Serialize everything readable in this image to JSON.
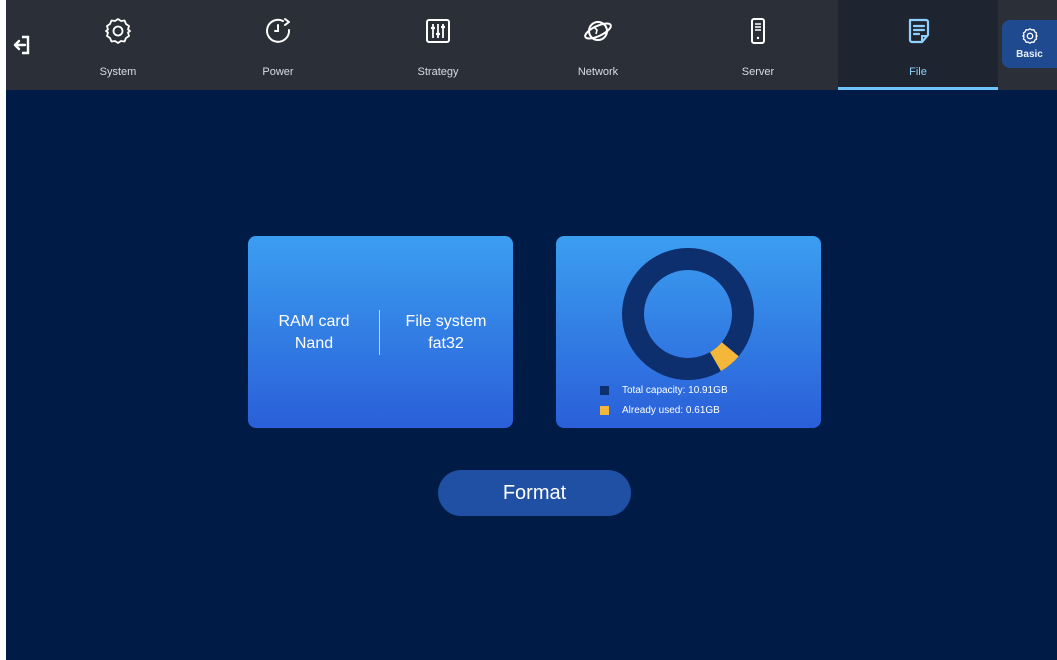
{
  "tabs": [
    {
      "label": "System",
      "icon": "gear-icon"
    },
    {
      "label": "Power",
      "icon": "power-clock-icon"
    },
    {
      "label": "Strategy",
      "icon": "sliders-icon"
    },
    {
      "label": "Network",
      "icon": "planet-icon"
    },
    {
      "label": "Server",
      "icon": "server-icon"
    },
    {
      "label": "File",
      "icon": "document-icon",
      "active": true
    }
  ],
  "side_button": {
    "label": "Basic",
    "icon": "gear-icon"
  },
  "storage_info": {
    "card_label": "RAM card",
    "card_value": "Nand",
    "fs_label": "File system",
    "fs_value": "fat32"
  },
  "capacity": {
    "total_text": "Total capacity: 10.91GB",
    "used_text": "Already used: 0.61GB",
    "total_gb": 10.91,
    "used_gb": 0.61,
    "total_color": "#0d2f6e",
    "used_color": "#f4b73a"
  },
  "format_button": "Format",
  "colors": {
    "background": "#011b47",
    "topbar": "#2a2f38",
    "accent": "#6fc3ff"
  }
}
